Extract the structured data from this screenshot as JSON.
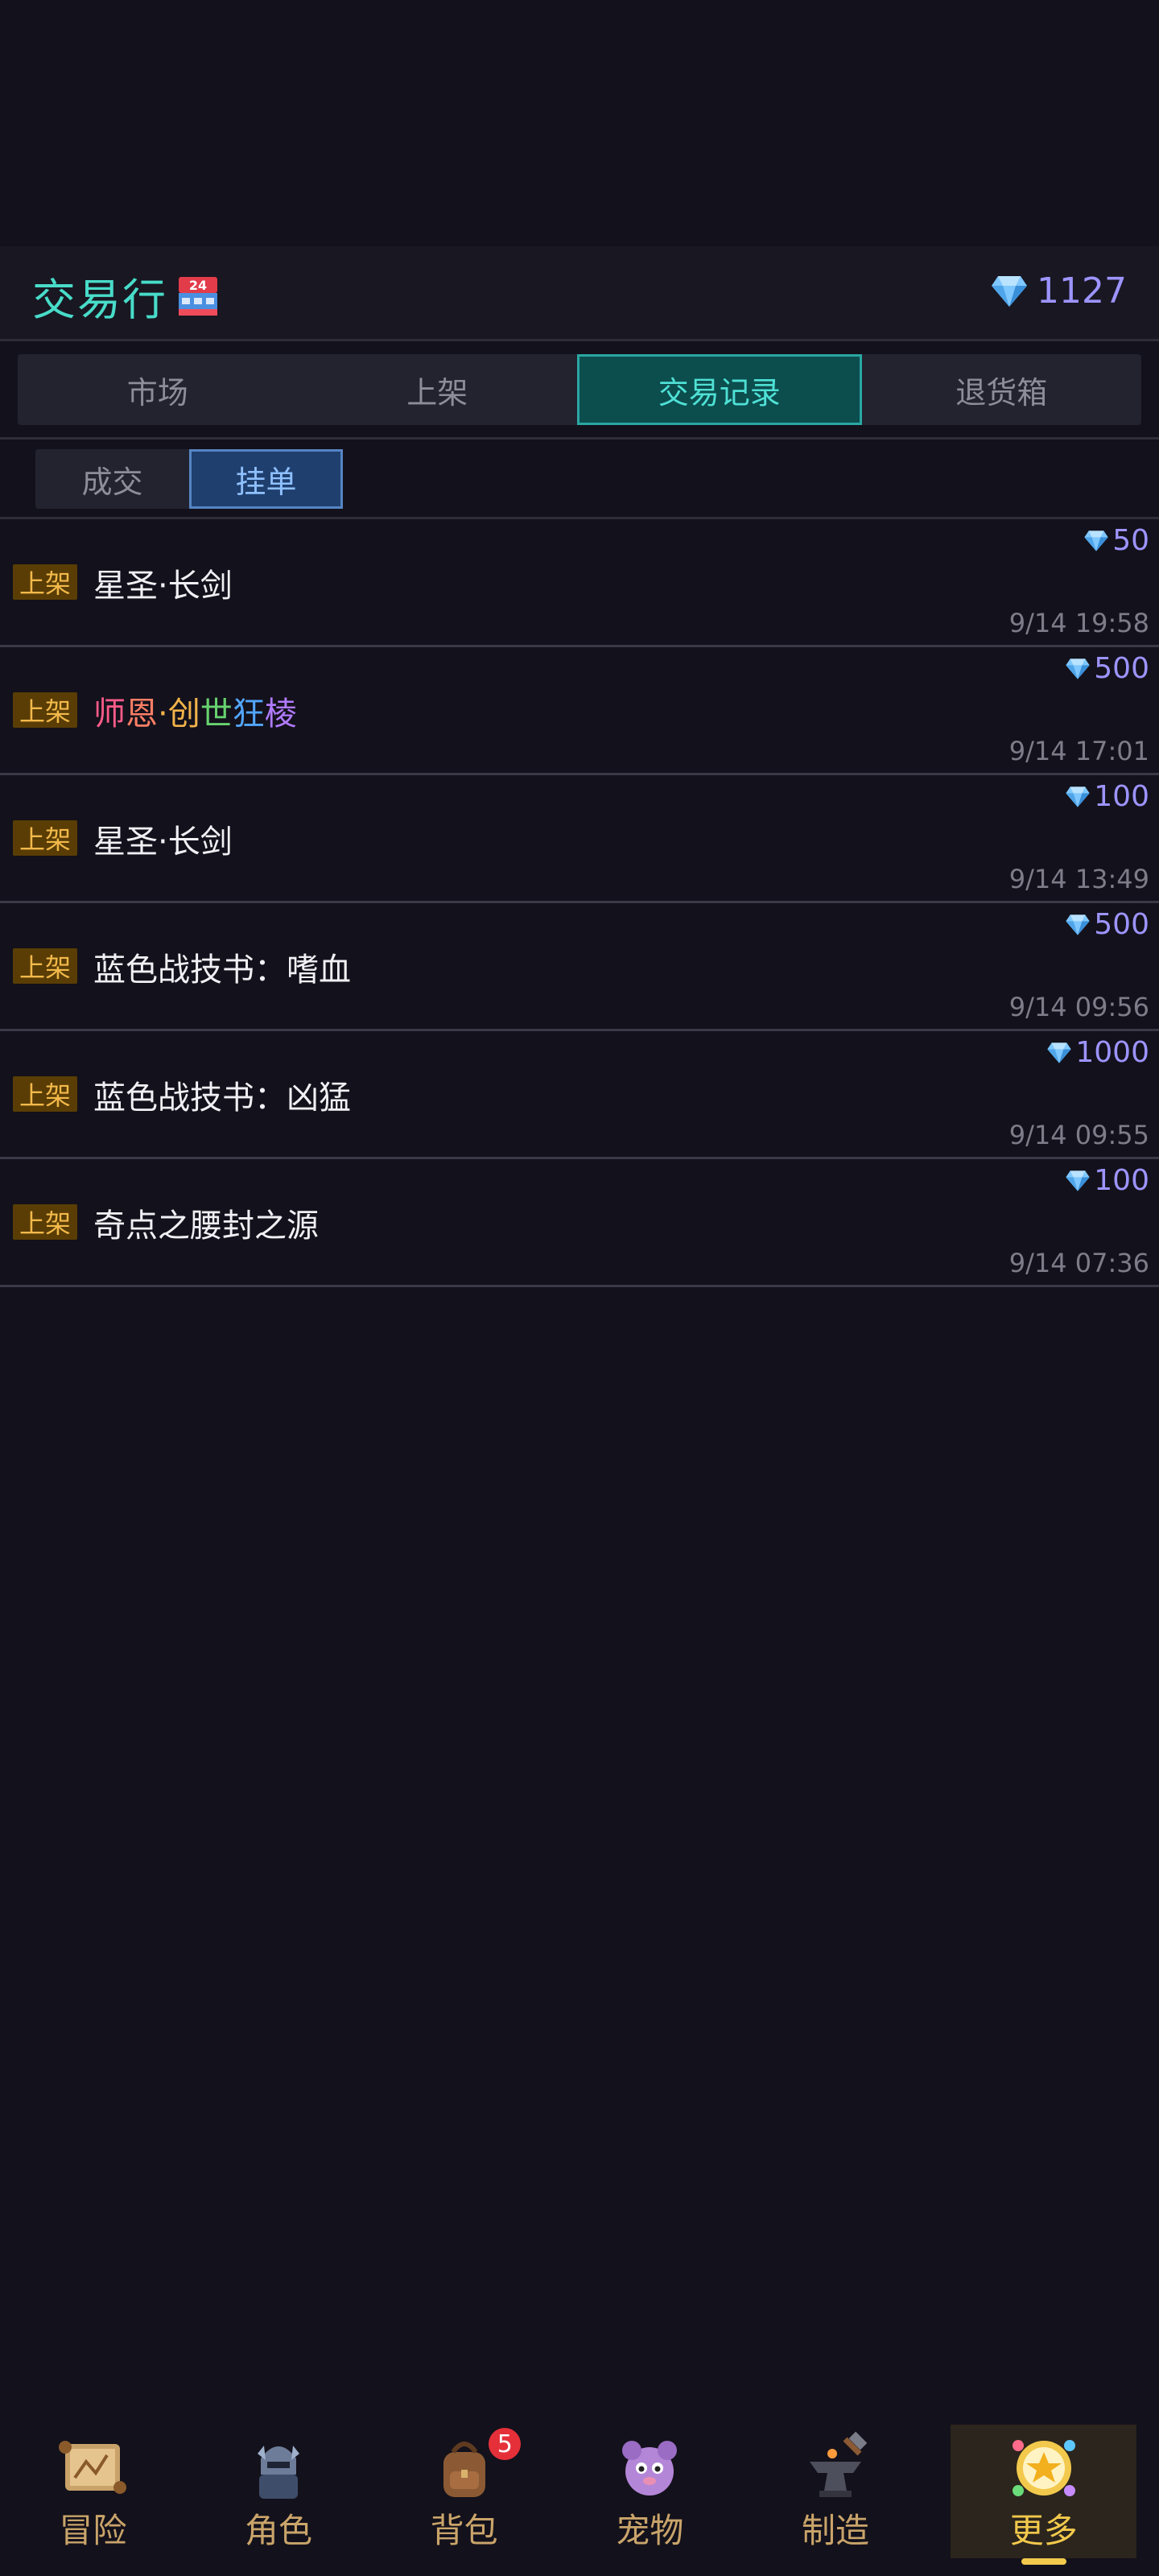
{
  "header": {
    "title": "交易行",
    "gem_balance": "1127",
    "accent_color": "#48dcc9"
  },
  "main_tabs": [
    {
      "label": "市场",
      "active": false
    },
    {
      "label": "上架",
      "active": false
    },
    {
      "label": "交易记录",
      "active": true
    },
    {
      "label": "退货箱",
      "active": false
    }
  ],
  "sub_tabs": [
    {
      "label": "成交",
      "active": false
    },
    {
      "label": "挂单",
      "active": true
    }
  ],
  "records": [
    {
      "tag": "上架",
      "name": "星圣·长剑",
      "price": "50",
      "time": "9/14 19:58"
    },
    {
      "tag": "上架",
      "name": "师恩·创世狂棱",
      "price": "500",
      "time": "9/14 17:01",
      "rainbow": true
    },
    {
      "tag": "上架",
      "name": "星圣·长剑",
      "price": "100",
      "time": "9/14 13:49"
    },
    {
      "tag": "上架",
      "name": "蓝色战技书：嗜血",
      "price": "500",
      "time": "9/14 09:56"
    },
    {
      "tag": "上架",
      "name": "蓝色战技书：凶猛",
      "price": "1000",
      "time": "9/14 09:55"
    },
    {
      "tag": "上架",
      "name": "奇点之腰封之源",
      "price": "100",
      "time": "9/14 07:36"
    }
  ],
  "bottom_nav": [
    {
      "label": "冒险",
      "icon": "scroll-map-icon"
    },
    {
      "label": "角色",
      "icon": "knight-icon"
    },
    {
      "label": "背包",
      "icon": "backpack-icon",
      "badge": "5"
    },
    {
      "label": "宠物",
      "icon": "pet-icon"
    },
    {
      "label": "制造",
      "icon": "anvil-icon"
    },
    {
      "label": "更多",
      "icon": "star-medal-icon",
      "active": true
    }
  ]
}
